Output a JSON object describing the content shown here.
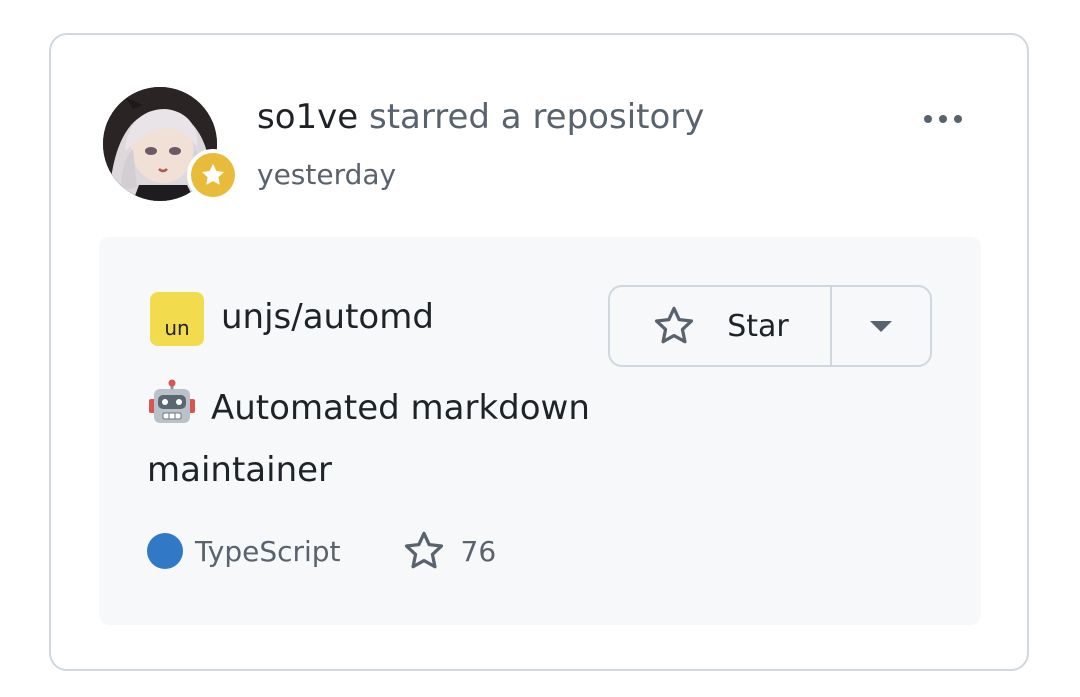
{
  "event": {
    "actor": "so1ve",
    "action": "starred a repository",
    "timestamp": "yesterday",
    "avatar_icon": "user-avatar",
    "badge_icon": "star-icon",
    "badge_color": "#e8bb3a",
    "more_icon": "kebab-horizontal-icon"
  },
  "repo": {
    "owner_avatar_text": "un",
    "owner_avatar_color": "#f2dc4d",
    "full_name": "unjs/automd",
    "description": "Automated markdown maintainer",
    "description_emoji_icon": "robot-icon",
    "language": "TypeScript",
    "language_color": "#3178c6",
    "stars": "76"
  },
  "star_button": {
    "label": "Star",
    "icon": "star-outline-icon",
    "dropdown_icon": "caret-down-icon"
  }
}
